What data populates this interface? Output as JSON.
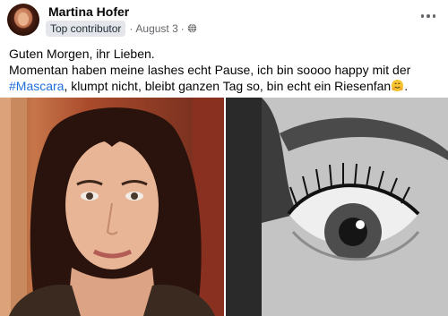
{
  "post": {
    "author": "Martina Hofer",
    "badge": "Top contributor",
    "separator": "·",
    "date": "August 3",
    "dot": "·",
    "privacy_icon": "globe-icon",
    "menu_icon": "more-options-icon",
    "text_line1": "Guten Morgen,  ihr Lieben.",
    "text_line2": "Momentan haben meine lashes echt Pause,  ich bin soooo happy mit der",
    "hashtag": "#Mascara",
    "text_line3_rest": ", klumpt nicht, bleibt ganzen Tag so, bin echt ein Riesenfan",
    "text_line3_end": ".",
    "emoji": "hugging-face-emoji"
  },
  "colors": {
    "hashtag": "#216fdb",
    "secondary_text": "#65676b",
    "badge_bg": "#e4e6eb"
  },
  "photos": [
    {
      "name": "woman-portrait-photo"
    },
    {
      "name": "eye-closeup-photo"
    }
  ]
}
